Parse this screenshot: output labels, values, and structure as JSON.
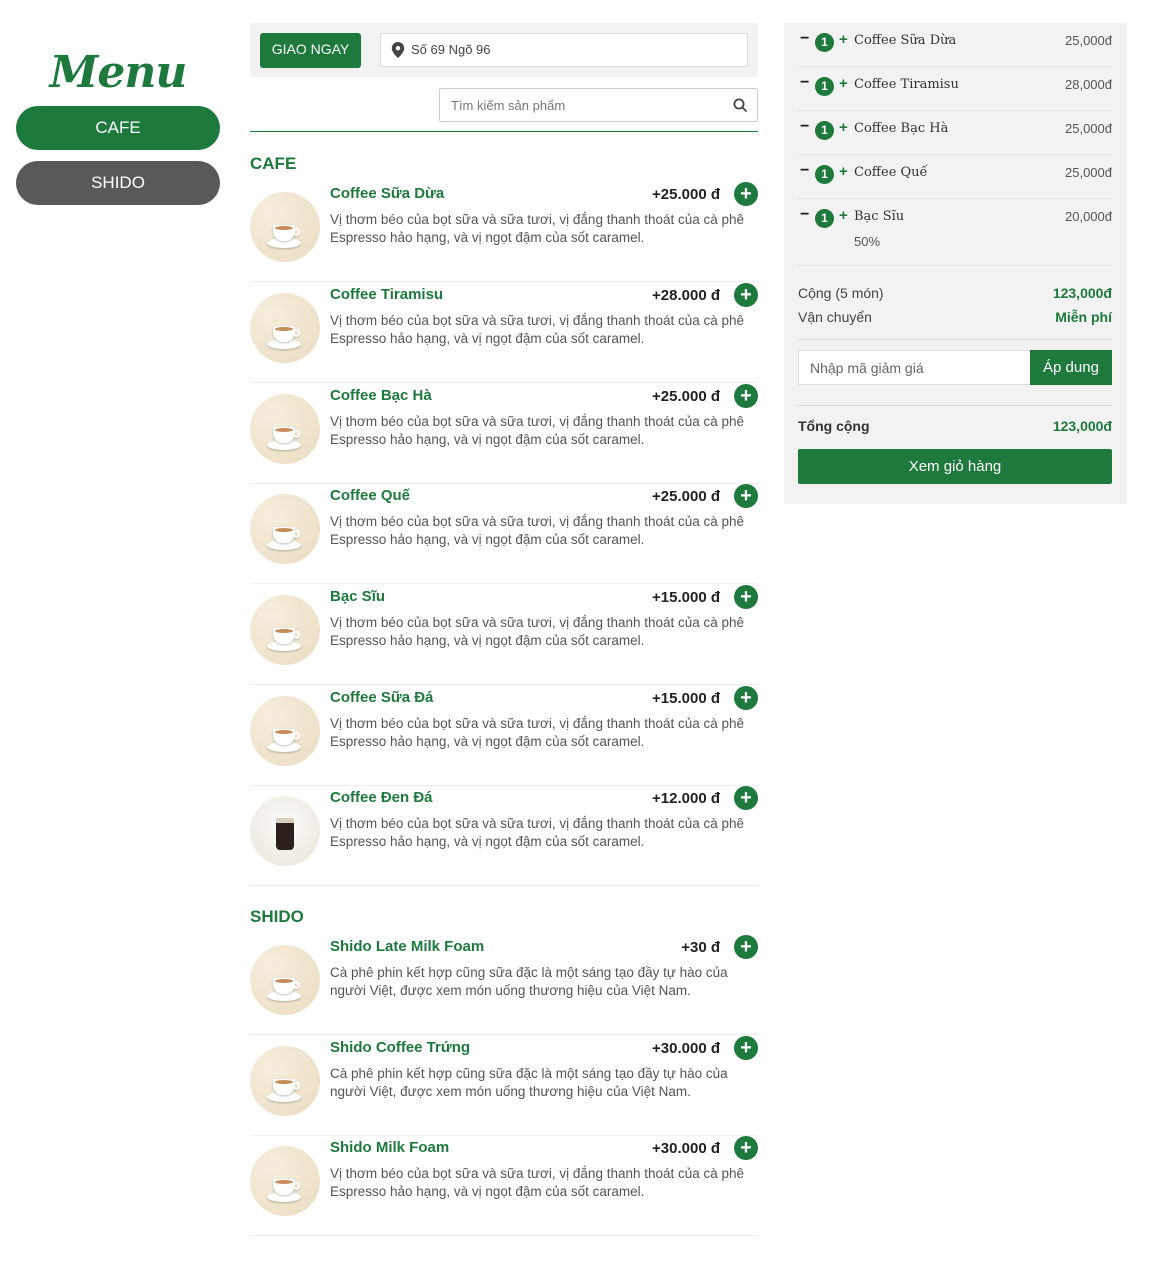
{
  "sidebar": {
    "logo": "Menu",
    "categories": [
      {
        "label": "CAFE",
        "active": true
      },
      {
        "label": "SHIDO",
        "active": false
      }
    ]
  },
  "header": {
    "deliver_label": "GIAO NGAY",
    "address": "Số 69 Ngõ 96",
    "search_placeholder": "Tìm kiếm sản phẩm"
  },
  "sections": [
    {
      "title": "CAFE",
      "items": [
        {
          "name": "Coffee Sữa Dừa",
          "price": "+25.000 đ",
          "desc_line1": "Vị thơm béo của bọt sữa và sữa tươi, vị đắng thanh thoát của cà phê",
          "desc_line2": "Espresso hảo hạng, và vị ngọt đậm của sốt caramel."
        },
        {
          "name": "Coffee Tiramisu",
          "price": "+28.000 đ",
          "desc_line1": "Vị thơm béo của bọt sữa và sữa tươi, vị đắng thanh thoát của cà phê",
          "desc_line2": "Espresso hảo hạng, và vị ngọt đậm của sốt caramel."
        },
        {
          "name": "Coffee Bạc Hà",
          "price": "+25.000 đ",
          "desc_line1": "Vị thơm béo của bọt sữa và sữa tươi, vị đắng thanh thoát của cà phê",
          "desc_line2": "Espresso hảo hạng, và vị ngọt đậm của sốt caramel."
        },
        {
          "name": "Coffee Quế",
          "price": "+25.000 đ",
          "desc_line1": "Vị thơm béo của bọt sữa và sữa tươi, vị đắng thanh thoát của cà phê",
          "desc_line2": "Espresso hảo hạng, và vị ngọt đậm của sốt caramel."
        },
        {
          "name": "Bạc Sĩu",
          "price": "+15.000 đ",
          "desc_line1": "Vị thơm béo của bọt sữa và sữa tươi, vị đắng thanh thoát của cà phê",
          "desc_line2": "Espresso hảo hạng, và vị ngọt đậm của sốt caramel."
        },
        {
          "name": "Coffee Sữa Đá",
          "price": "+15.000 đ",
          "desc_line1": "Vị thơm béo của bọt sữa và sữa tươi, vị đắng thanh thoát của cà phê",
          "desc_line2": "Espresso hảo hạng, và vị ngọt đậm của sốt caramel."
        },
        {
          "name": "Coffee Đen Đá",
          "price": "+12.000 đ",
          "desc_line1": "Vị thơm béo của bọt sữa và sữa tươi, vị đắng thanh thoát của cà phê",
          "desc_line2": "Espresso hảo hạng, và vị ngọt đậm của sốt caramel."
        }
      ]
    },
    {
      "title": "SHIDO",
      "items": [
        {
          "name": "Shido Late Milk Foam",
          "price": "+30 đ",
          "desc_line1": "Cà phê phin kết hợp cũng sữa đặc là một sáng tạo đầy tự hào của",
          "desc_line2": "người Việt, được xem món uống thương hiệu của Việt Nam."
        },
        {
          "name": "Shido Coffee Trứng",
          "price": "+30.000 đ",
          "desc_line1": "Cà phê phin kết hợp cũng sữa đặc là một sáng tạo đầy tự hào của",
          "desc_line2": "người Việt, được xem món uống thương hiệu của Việt Nam."
        },
        {
          "name": "Shido Milk Foam",
          "price": "+30.000 đ",
          "desc_line1": "Vị thơm béo của bọt sữa và sữa tươi, vị đắng thanh thoát của cà phê",
          "desc_line2": "Espresso hảo hạng, và vị ngọt đậm của sốt caramel."
        }
      ]
    }
  ],
  "cart": {
    "items": [
      {
        "qty": "1",
        "name": "Coffee Sữa Dừa",
        "price": "25,000đ",
        "note": ""
      },
      {
        "qty": "1",
        "name": "Coffee Tiramisu",
        "price": "28,000đ",
        "note": ""
      },
      {
        "qty": "1",
        "name": "Coffee Bạc Hà",
        "price": "25,000đ",
        "note": ""
      },
      {
        "qty": "1",
        "name": "Coffee Quế",
        "price": "25,000đ",
        "note": ""
      },
      {
        "qty": "1",
        "name": "Bạc Sĩu",
        "price": "20,000đ",
        "note": "50%"
      }
    ],
    "subtotal_label": "Cộng (5 món)",
    "subtotal_value": "123,000đ",
    "shipping_label": "Vận chuyển",
    "shipping_value": "Miễn phí",
    "coupon_placeholder": "Nhập mã giảm giá",
    "apply_label": "Áp dung",
    "total_label": "Tổng cộng",
    "total_value": "123,000đ",
    "view_cart_label": "Xem giỏ hàng"
  },
  "colors": {
    "accent": "#1d7a3c",
    "inactive": "#595959",
    "panel": "#f2f2f2"
  },
  "icons": {
    "address": "map-pin-icon",
    "search": "search-icon",
    "add": "plus-circle-icon"
  }
}
